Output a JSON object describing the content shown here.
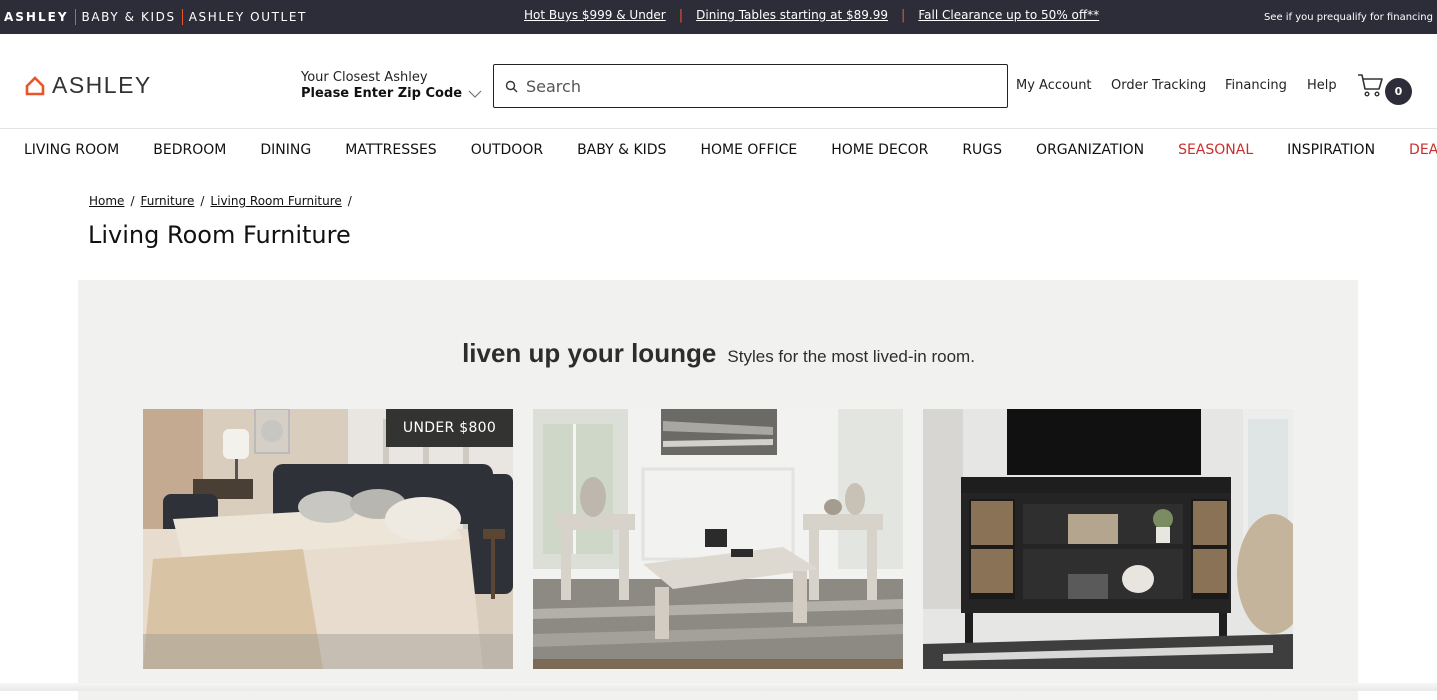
{
  "topbar": {
    "brands": [
      "ASHLEY",
      "BABY & KIDS",
      "ASHLEY OUTLET"
    ],
    "promos": [
      "Hot Buys $999 & Under",
      "Dining Tables starting at $89.99",
      "Fall Clearance up to 50% off**"
    ],
    "prequalify": "See if you prequalify for financing"
  },
  "header": {
    "logo_text": "ASHLEY",
    "zip_line1": "Your Closest Ashley",
    "zip_line2": "Please Enter Zip Code",
    "search_placeholder": "Search",
    "links": [
      "My Account",
      "Order Tracking",
      "Financing",
      "Help"
    ],
    "cart_count": "0"
  },
  "nav": {
    "items": [
      "LIVING ROOM",
      "BEDROOM",
      "DINING",
      "MATTRESSES",
      "OUTDOOR",
      "BABY & KIDS",
      "HOME OFFICE",
      "HOME DECOR",
      "RUGS",
      "ORGANIZATION",
      "SEASONAL",
      "INSPIRATION",
      "DEALS"
    ]
  },
  "breadcrumb": [
    "Home",
    "Furniture",
    "Living Room Furniture"
  ],
  "page_title": "Living Room Furniture",
  "banner": {
    "headline": "liven up your lounge",
    "subhead": "Styles for the most lived-in room.",
    "tag": "UNDER $800"
  },
  "colors": {
    "topbar_bg": "#2d2d3a",
    "accent_orange": "#e8552b",
    "nav_red": "#c9302c",
    "banner_bg": "#f1f2f0"
  }
}
